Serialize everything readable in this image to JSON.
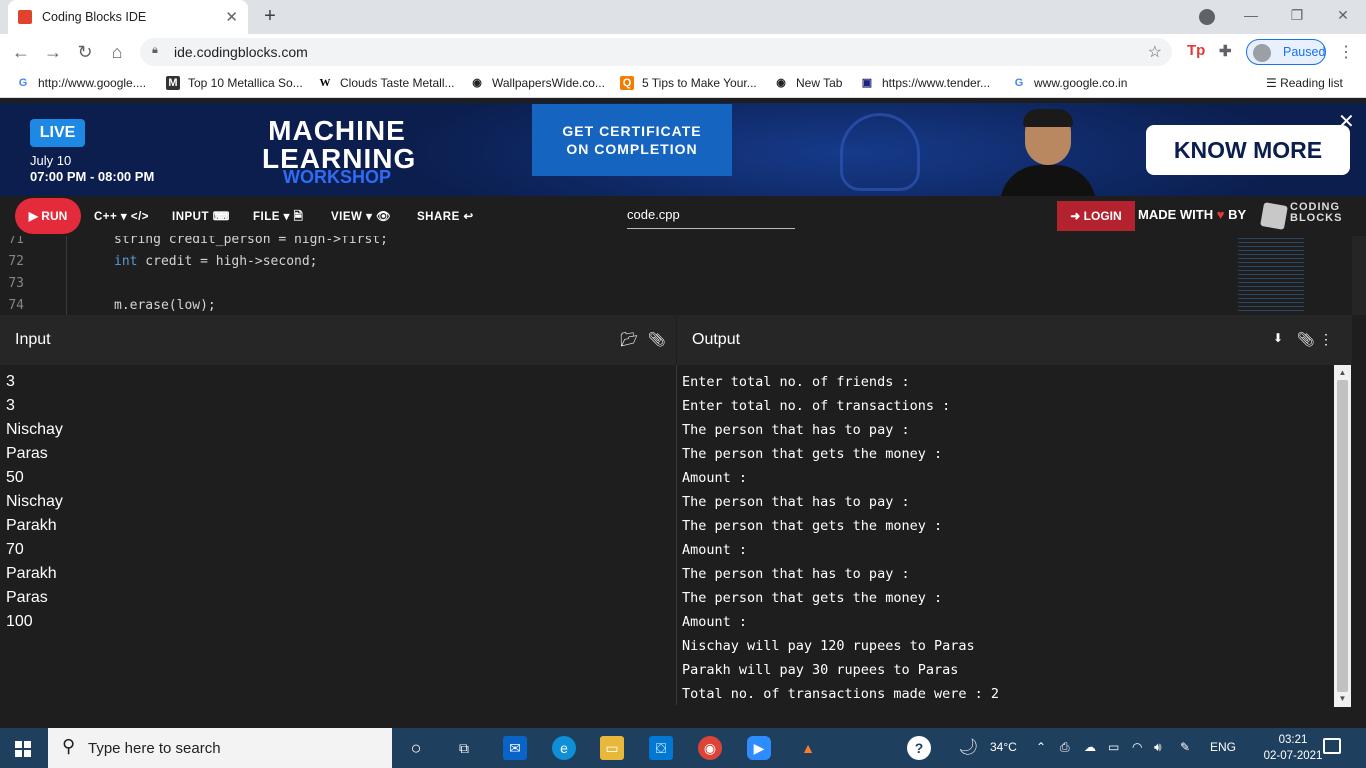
{
  "browser": {
    "tab_title": "Coding Blocks IDE",
    "tab_close": "✕",
    "new_tab": "+",
    "url": "ide.codingblocks.com",
    "profile_status": "Paused",
    "bookmarks": [
      {
        "label": "http://www.google....",
        "icon": "G",
        "color": "#4285f4"
      },
      {
        "label": "Top 10 Metallica So...",
        "icon": "M",
        "color": "#333333"
      },
      {
        "label": "Clouds Taste Metall...",
        "icon": "W",
        "color": "#000000"
      },
      {
        "label": "WallpapersWide.co...",
        "icon": "◉",
        "color": "#222222"
      },
      {
        "label": "5 Tips to Make Your...",
        "icon": "Q",
        "color": "#f57c00"
      },
      {
        "label": "New Tab",
        "icon": "◉",
        "color": "#222222"
      },
      {
        "label": "https://www.tender...",
        "icon": "▣",
        "color": "#1a237e"
      },
      {
        "label": "www.google.co.in",
        "icon": "G",
        "color": "#4285f4"
      }
    ],
    "reading_list": "Reading list"
  },
  "banner": {
    "live": "LIVE",
    "date": "July 10",
    "time": "07:00 PM - 08:00 PM",
    "title_line1": "MACHINE",
    "title_line2": "LEARNING",
    "title_line3": "WORKSHOP",
    "cert_line1": "GET CERTIFICATE",
    "cert_line2": "ON COMPLETION",
    "cta": "KNOW MORE",
    "close": "✕"
  },
  "menubar": {
    "run": "▶ RUN",
    "language": "C++ ▾ </>",
    "input": "INPUT ⌨",
    "file": "FILE ▾ 🗎",
    "view": "VIEW ▾ 👁",
    "share": "SHARE ↩",
    "filename": "code.cpp",
    "login": "➜ LOGIN",
    "made_with": "MADE WITH",
    "by": "BY",
    "brand_line1": "CODING",
    "brand_line2": "BLOCKS"
  },
  "editor": {
    "lines": [
      {
        "num": "71",
        "pre": "",
        "kw": "",
        "rest": "string credit_person = high->first;"
      },
      {
        "num": "72",
        "pre": "",
        "kw": "int",
        "rest": " credit = high->second;"
      },
      {
        "num": "73",
        "pre": "",
        "kw": "",
        "rest": ""
      },
      {
        "num": "74",
        "pre": "",
        "kw": "",
        "rest": "m.erase(low);"
      }
    ]
  },
  "input_panel": {
    "title": "Input",
    "lines": [
      "3",
      "3",
      "Nischay",
      "Paras",
      "50",
      "Nischay",
      "Parakh",
      "70",
      "Parakh",
      "Paras",
      "100"
    ]
  },
  "output_panel": {
    "title": "Output",
    "lines": [
      "Enter total no. of friends :",
      "Enter total no. of transactions :",
      "The person that has to pay :",
      "The person that gets the money :",
      "Amount :",
      "The person that has to pay :",
      "The person that gets the money :",
      "Amount :",
      "The person that has to pay :",
      "The person that gets the money :",
      "Amount :",
      "Nischay will pay 120 rupees to Paras",
      "Parakh will pay 30 rupees to Paras",
      "Total no. of transactions made were : 2"
    ]
  },
  "taskbar": {
    "search_placeholder": "Type here to search",
    "weather": "34°C",
    "language": "ENG",
    "time": "03:21",
    "date": "02-07-2021"
  }
}
